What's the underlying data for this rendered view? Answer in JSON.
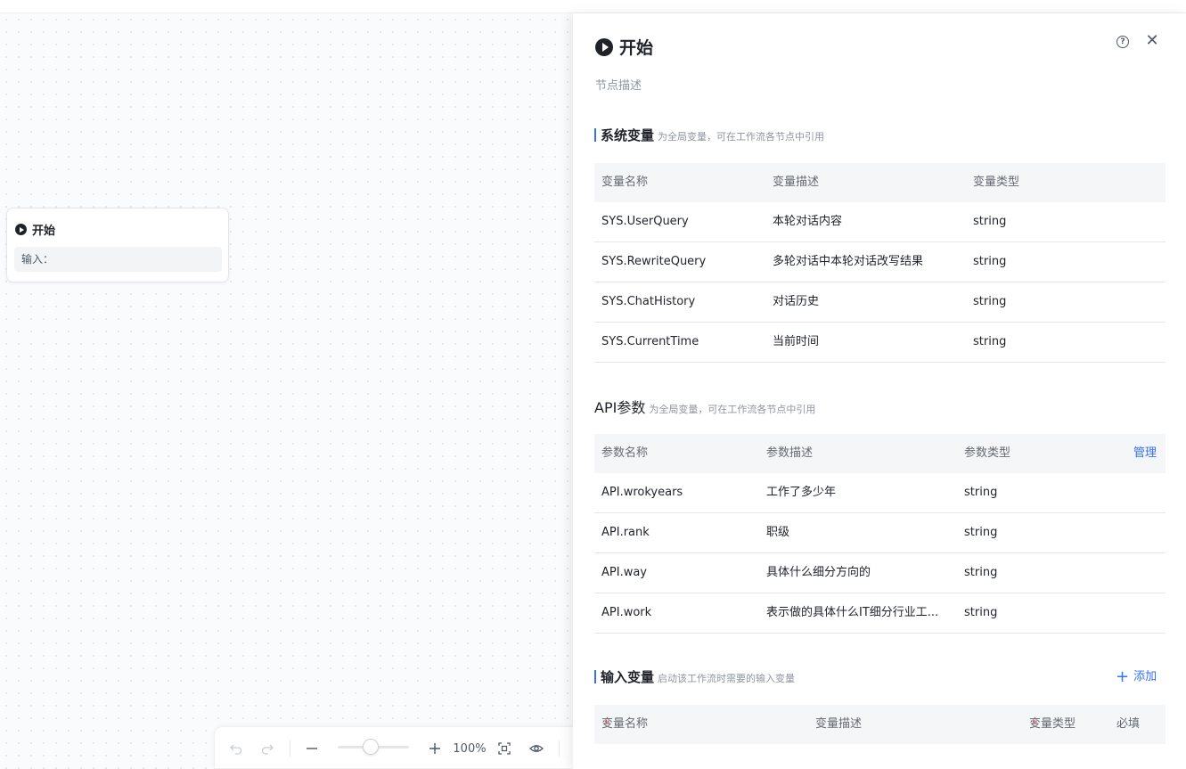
{
  "node": {
    "title": "开始",
    "input_label": "输入："
  },
  "toolbar": {
    "zoom": "100%"
  },
  "panel": {
    "title": "开始",
    "description_placeholder": "节点描述",
    "system_vars": {
      "title": "系统变量",
      "subtitle": "为全局变量，可在工作流各节点中引用",
      "columns": [
        "变量名称",
        "变量描述",
        "变量类型"
      ],
      "rows": [
        {
          "name": "SYS.UserQuery",
          "desc": "本轮对话内容",
          "type": "string"
        },
        {
          "name": "SYS.RewriteQuery",
          "desc": "多轮对话中本轮对话改写结果",
          "type": "string"
        },
        {
          "name": "SYS.ChatHistory",
          "desc": "对话历史",
          "type": "string"
        },
        {
          "name": "SYS.CurrentTime",
          "desc": "当前时间",
          "type": "string"
        }
      ]
    },
    "api_params": {
      "title": "API参数",
      "subtitle": "为全局变量，可在工作流各节点中引用",
      "columns": [
        "参数名称",
        "参数描述",
        "参数类型"
      ],
      "manage_label": "管理",
      "rows": [
        {
          "name": "API.wrokyears",
          "desc": "工作了多少年",
          "type": "string"
        },
        {
          "name": "API.rank",
          "desc": "职级",
          "type": "string"
        },
        {
          "name": "API.way",
          "desc": "具体什么细分方向的",
          "type": "string"
        },
        {
          "name": "API.work",
          "desc": "表示做的具体什么IT细分行业工...",
          "type": "string"
        }
      ]
    },
    "input_vars": {
      "title": "输入变量",
      "subtitle": "启动该工作流时需要的输入变量",
      "add_label": "添加",
      "columns": [
        "变量名称",
        "变量描述",
        "变量类型",
        "必填"
      ],
      "required_mark": "*"
    }
  },
  "icons": {
    "play": "play-circle-icon",
    "help": "help-icon",
    "close": "close-icon",
    "undo": "undo-icon",
    "redo": "redo-icon",
    "zoom_out": "minus-icon",
    "zoom_in": "plus-icon",
    "fit": "fit-view-icon",
    "preview": "eye-icon",
    "add": "plus-icon"
  },
  "colors": {
    "accent": "#3370ff",
    "required": "#f54a45"
  }
}
